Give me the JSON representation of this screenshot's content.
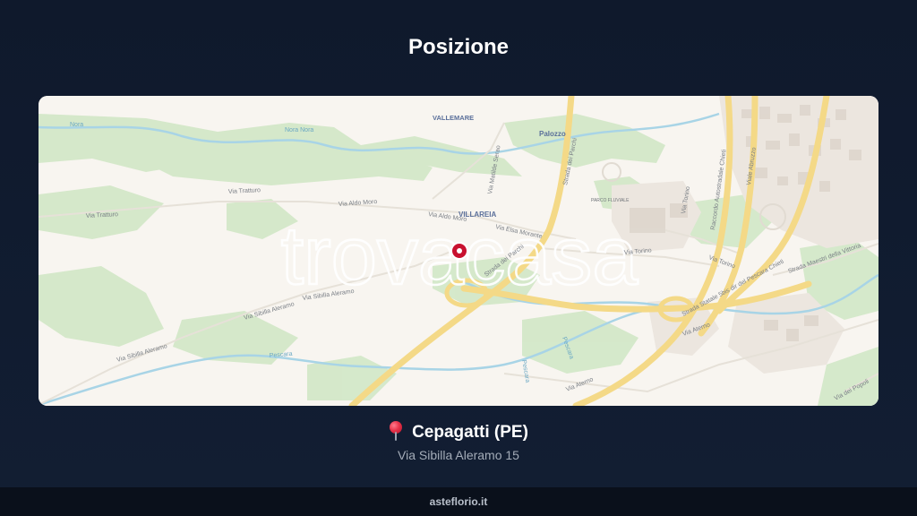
{
  "header": {
    "title": "Posizione"
  },
  "map": {
    "watermark": "trovacasa",
    "marker_color": "#c8102e",
    "labels": {
      "vallemare": "VALLEMARE",
      "palozzo": "Palozzo",
      "villareia": "VILLAREIA",
      "parco_fluviale": "PARCO FLUVIALE",
      "via_tratturo_1": "Via Tratturo",
      "via_tratturo_2": "Via Tratturo",
      "via_aldo_moro": "Via Aldo Moro",
      "via_aldo_moro_2": "Via Aldo Moro",
      "via_elsa_morante": "Via Elsa Morante",
      "via_sibilla_aleramo_1": "Via Sibilla Aleramo",
      "via_sibilla_aleramo_2": "Via Sibilla Aleramo",
      "via_sibilla_aleramo_3": "Via Sibilla Aleramo",
      "strada_dei_parchi_1": "Strada dei Parchi",
      "strada_dei_parchi_2": "Strada dei Parchi",
      "via_matilde_serao": "Via Matilde Serao",
      "via_torino_1": "Via Torino",
      "via_torino_2": "Via Torino",
      "via_torino_3": "Via Torino",
      "raccordo": "Raccordo Autostradale Chieti",
      "viale_abruzzo": "Viale Abruzzo",
      "strada_statale": "Strada Statale 5bis dir del Pescara Chieti",
      "strada_maestri": "Strada Maestri della Vittoria",
      "via_aterno_1": "Via Aterno",
      "via_aterno_2": "Via Aterno",
      "via_popoli": "Via dei Popoli",
      "pescara_1": "Pescara",
      "pescara_2": "Pescara",
      "nora_1": "Nora",
      "nora_2": "Nora Nora",
      "pescara_3": "Pescara"
    }
  },
  "location": {
    "city": "Cepagatti (PE)",
    "address": "Via Sibilla Aleramo 15",
    "pin_icon": "round-pushpin-icon"
  },
  "footer": {
    "site": "asteflorio.it"
  }
}
